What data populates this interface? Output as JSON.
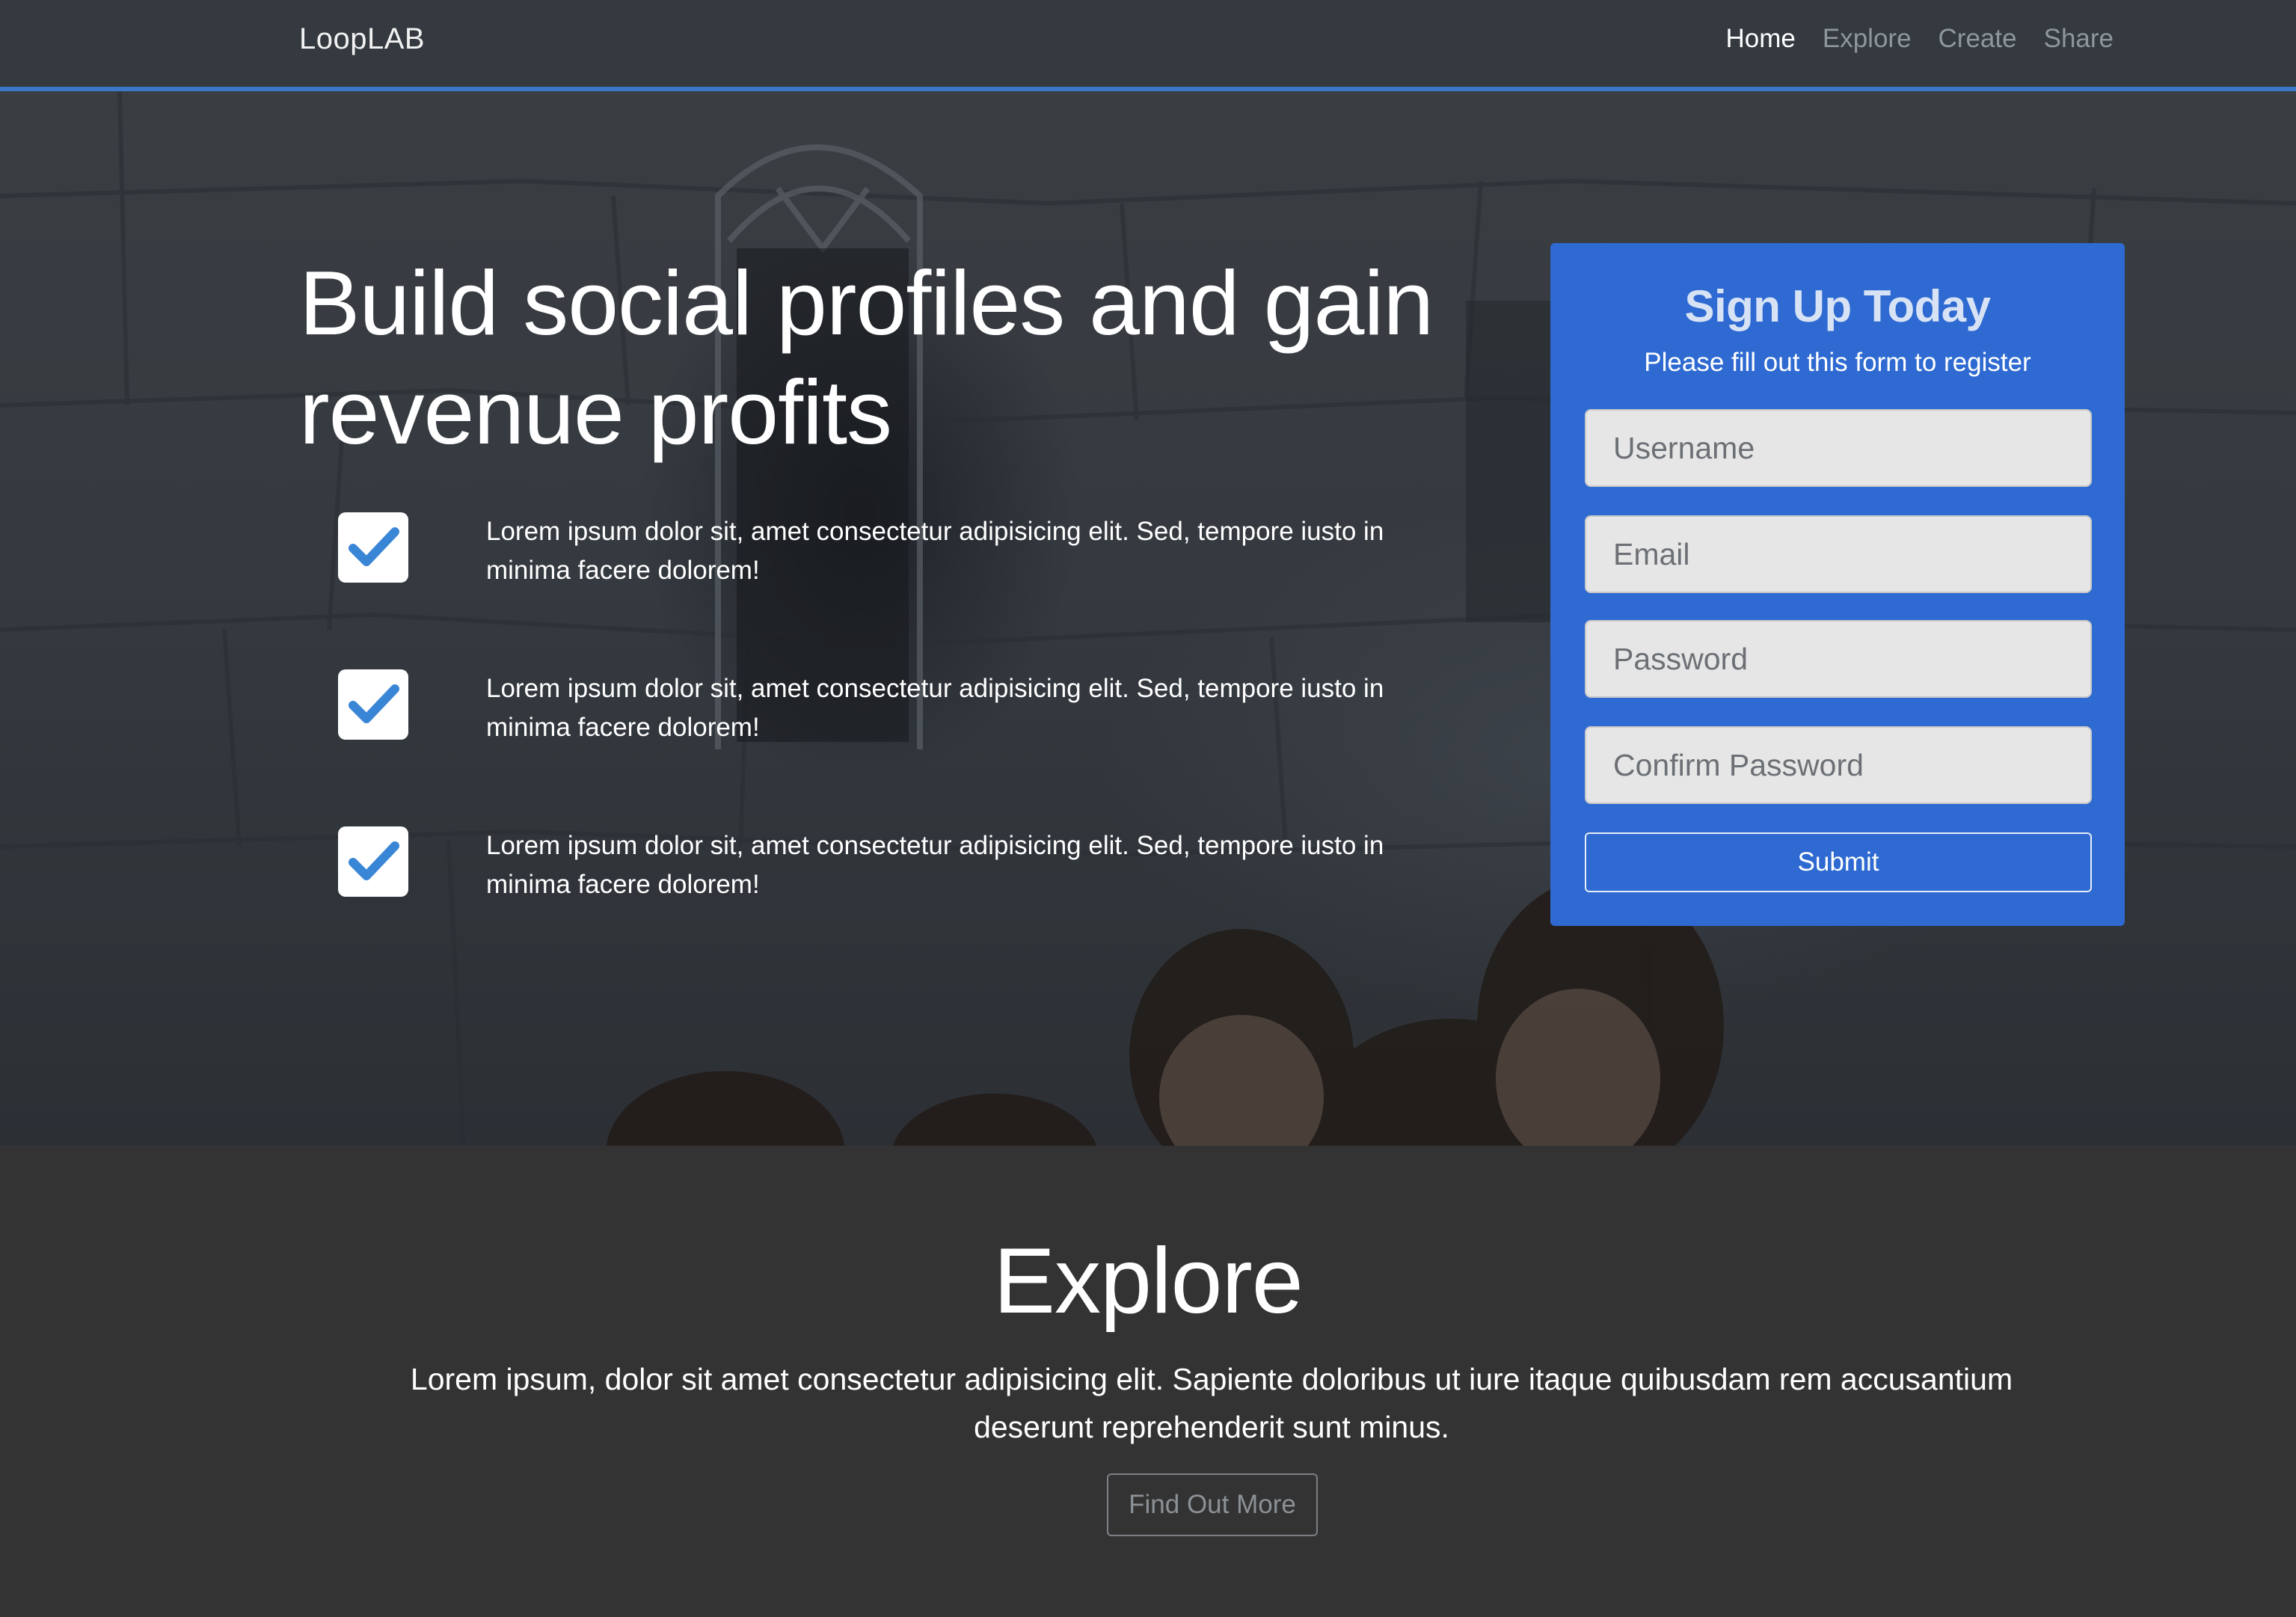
{
  "navbar": {
    "brand": "LoopLAB",
    "links": [
      {
        "label": "Home",
        "active": true
      },
      {
        "label": "Explore",
        "active": false
      },
      {
        "label": "Create",
        "active": false
      },
      {
        "label": "Share",
        "active": false
      }
    ]
  },
  "hero": {
    "headline": {
      "part1": "Build ",
      "part2": "social profiles",
      "part3": " and gain revenue ",
      "part4": "profits"
    },
    "features": [
      {
        "icon": "check-icon",
        "text": "Lorem ipsum dolor sit, amet consectetur adipisicing elit. Sed, tempore iusto in minima facere dolorem!"
      },
      {
        "icon": "check-icon",
        "text": "Lorem ipsum dolor sit, amet consectetur adipisicing elit. Sed, tempore iusto in minima facere dolorem!"
      },
      {
        "icon": "check-icon",
        "text": "Lorem ipsum dolor sit, amet consectetur adipisicing elit. Sed, tempore iusto in minima facere dolorem!"
      }
    ]
  },
  "signup": {
    "title": "Sign Up Today",
    "subtitle": "Please fill out this form to register",
    "fields": {
      "username": {
        "placeholder": "Username",
        "value": ""
      },
      "email": {
        "placeholder": "Email",
        "value": ""
      },
      "password": {
        "placeholder": "Password",
        "value": ""
      },
      "confirm": {
        "placeholder": "Confirm Password",
        "value": ""
      }
    },
    "submit_label": "Submit"
  },
  "explore": {
    "title": "Explore",
    "text": "Lorem ipsum, dolor sit amet consectetur adipisicing elit. Sapiente doloribus ut iure itaque quibusdam rem accusantium deserunt reprehenderit sunt minus.",
    "button_label": "Find Out More"
  },
  "colors": {
    "accent": "#2e6ad1",
    "nav_border": "#3a78c9",
    "check": "#3a86d6",
    "dark_bg": "#333333"
  }
}
